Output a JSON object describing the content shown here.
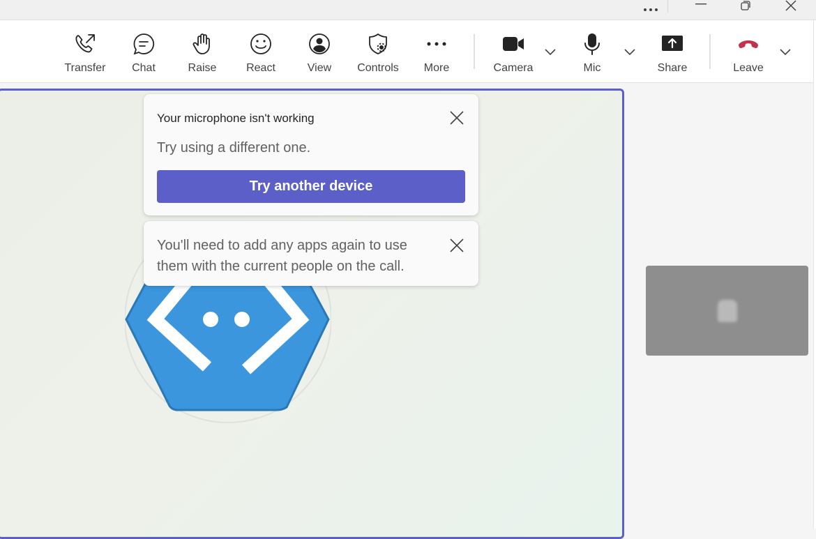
{
  "titlebar": {
    "more_icon": "ellipsis-icon",
    "minimize_icon": "minimize-icon",
    "restore_icon": "restore-icon",
    "close_icon": "close-icon"
  },
  "toolbar": {
    "transfer": {
      "label": "Transfer",
      "icon": "phone-transfer-icon"
    },
    "chat": {
      "label": "Chat",
      "icon": "chat-icon"
    },
    "raise": {
      "label": "Raise",
      "icon": "raise-hand-icon"
    },
    "react": {
      "label": "React",
      "icon": "smiley-icon"
    },
    "view": {
      "label": "View",
      "icon": "view-icon"
    },
    "controls": {
      "label": "Controls",
      "icon": "shield-gear-icon"
    },
    "more": {
      "label": "More",
      "icon": "ellipsis-icon"
    },
    "camera": {
      "label": "Camera",
      "icon": "video-camera-icon"
    },
    "mic": {
      "label": "Mic",
      "icon": "microphone-icon"
    },
    "share": {
      "label": "Share",
      "icon": "share-screen-icon"
    },
    "leave": {
      "label": "Leave",
      "icon": "hang-up-icon",
      "color": "#c4314b"
    }
  },
  "mic_popup": {
    "title": "Your microphone isn't working",
    "subtitle": "Try using a different one.",
    "button": "Try another device"
  },
  "apps_popup": {
    "message": "You'll need to add any apps again to use them with the current people on the call."
  },
  "colors": {
    "accent": "#5b5fc7",
    "avatar_blue": "#3b96dd"
  }
}
